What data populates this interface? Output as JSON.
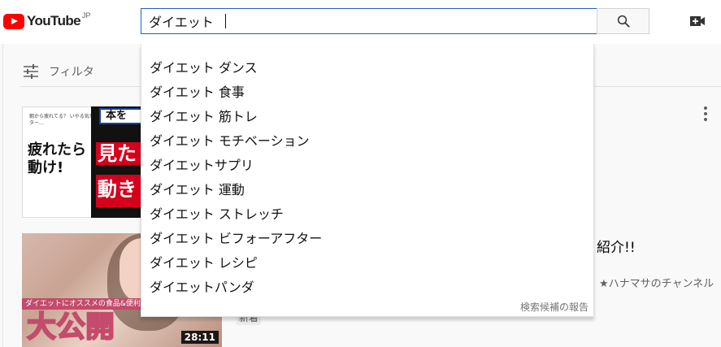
{
  "header": {
    "logo_text": "YouTube",
    "country_code": "JP",
    "search_value": "ダイエット",
    "search_icon": "search-icon",
    "create_icon": "video-camera-plus-icon"
  },
  "suggestions": {
    "items": [
      "ダイエット ダンス",
      "ダイエット 食事",
      "ダイエット 筋トレ",
      "ダイエット モチベーション",
      "ダイエットサプリ",
      "ダイエット 運動",
      "ダイエット ストレッチ",
      "ダイエット ビフォーアフター",
      "ダイエット レシピ",
      "ダイエットパンダ"
    ],
    "report_label": "検索候補の報告"
  },
  "results": {
    "filter_label": "フィルタ",
    "video1": {
      "thumb_small_text": "朝から疲れてる？\nいやる気があるアパーター…",
      "thumb_main_text": "疲れたら\n動け!",
      "thumb_tag": "本を",
      "thumb_side_top": "見た",
      "thumb_side_bottom": "動き"
    },
    "video2": {
      "title_partial": "紹介!!",
      "channel": "★ハナマサのチャンネル",
      "badge": "新着",
      "thumb_banner": "ダイエットにオススメの食品&便利アイテム",
      "thumb_main_text": "大公開",
      "duration": "28:11"
    }
  }
}
